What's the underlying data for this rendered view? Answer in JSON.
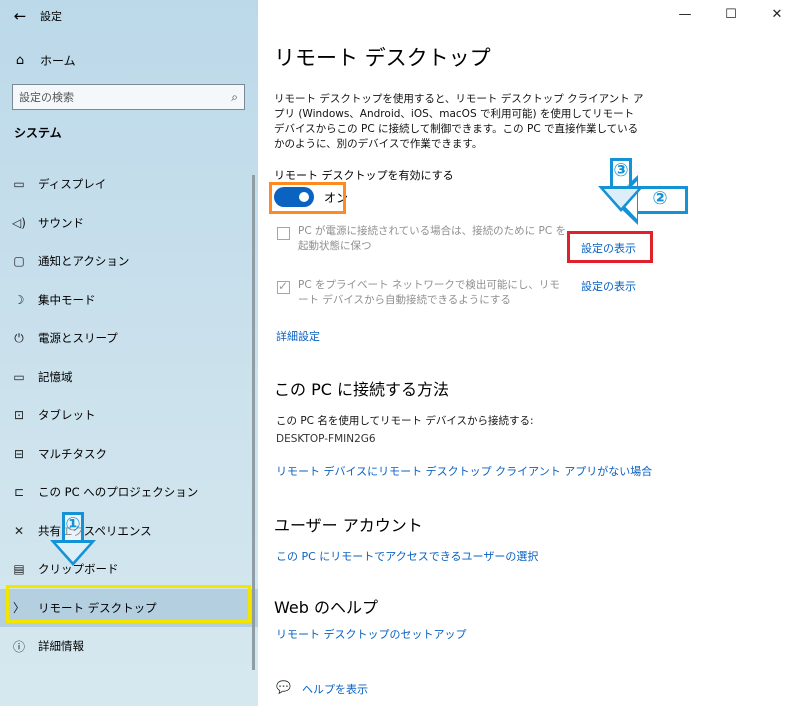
{
  "window": {
    "title": "設定",
    "minimize": "—",
    "maximize": "☐",
    "close": "✕"
  },
  "sidebar": {
    "back": "←",
    "home": "ホーム",
    "search_placeholder": "設定の検索",
    "section": "システム",
    "items": [
      {
        "label": "ディスプレイ",
        "icon": "▭"
      },
      {
        "label": "サウンド",
        "icon": "◁)"
      },
      {
        "label": "通知とアクション",
        "icon": "▢"
      },
      {
        "label": "集中モード",
        "icon": "☽"
      },
      {
        "label": "電源とスリープ",
        "icon": "⏻"
      },
      {
        "label": "記憶域",
        "icon": "▭"
      },
      {
        "label": "タブレット",
        "icon": "⊡"
      },
      {
        "label": "マルチタスク",
        "icon": "⊟"
      },
      {
        "label": "この PC へのプロジェクション",
        "icon": "⊏"
      },
      {
        "label": "共有エクスペリエンス",
        "icon": "✕"
      },
      {
        "label": "クリップボード",
        "icon": "▤"
      },
      {
        "label": "リモート デスクトップ",
        "icon": "〉"
      },
      {
        "label": "詳細情報",
        "icon": "ⓘ"
      }
    ]
  },
  "main": {
    "title": "リモート デスクトップ",
    "description": "リモート デスクトップを使用すると、リモート デスクトップ クライアント アプリ (Windows、Android、iOS、macOS で利用可能) を使用してリモート デバイスからこの PC に接続して制御できます。この PC で直接作業しているかのように、別のデバイスで作業できます。",
    "toggle_label": "リモート デスクトップを有効にする",
    "toggle_state": "オン",
    "option1": "PC が電源に接続されている場合は、接続のために PC を起動状態に保つ",
    "option2": "PC をプライベート ネットワークで検出可能にし、リモート デバイスから自動接続できるようにする",
    "show_settings": "設定の表示",
    "advanced": "詳細設定",
    "connect_heading": "この PC に接続する方法",
    "connect_text": "この PC 名を使用してリモート デバイスから接続する:",
    "pc_name": "DESKTOP-FMIN2G6",
    "no_client_link": "リモート デバイスにリモート デスクトップ クライアント アプリがない場合",
    "user_heading": "ユーザー アカウント",
    "user_link": "この PC にリモートでアクセスできるユーザーの選択",
    "web_heading": "Web のヘルプ",
    "web_link": "リモート デスクトップのセットアップ",
    "help": "ヘルプを表示"
  },
  "annotations": {
    "step1": "①",
    "step2": "②",
    "step3": "③"
  }
}
